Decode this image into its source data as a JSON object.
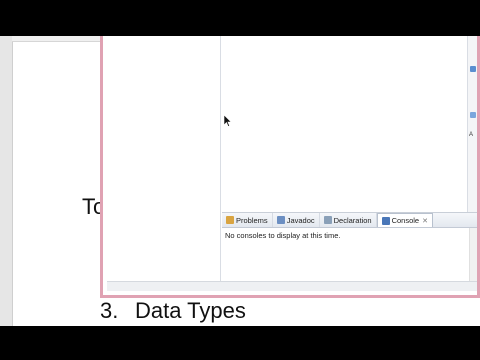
{
  "document": {
    "partial_text": "To",
    "heading_number": "3.",
    "heading_text": "Data Types"
  },
  "eclipse": {
    "bottom_tabs": [
      {
        "label": "Problems",
        "icon": "problems-icon",
        "active": false
      },
      {
        "label": "Javadoc",
        "icon": "javadoc-icon",
        "active": false
      },
      {
        "label": "Declaration",
        "icon": "declaration-icon",
        "active": false
      },
      {
        "label": "Console",
        "icon": "console-icon",
        "active": true
      }
    ],
    "console_close_glyph": "✕",
    "console_message": "No consoles to display at this time.",
    "right_strip_label": "A",
    "colors": {
      "window_border": "#e0a2b3",
      "tab_bar": "#e3e8ef"
    }
  }
}
